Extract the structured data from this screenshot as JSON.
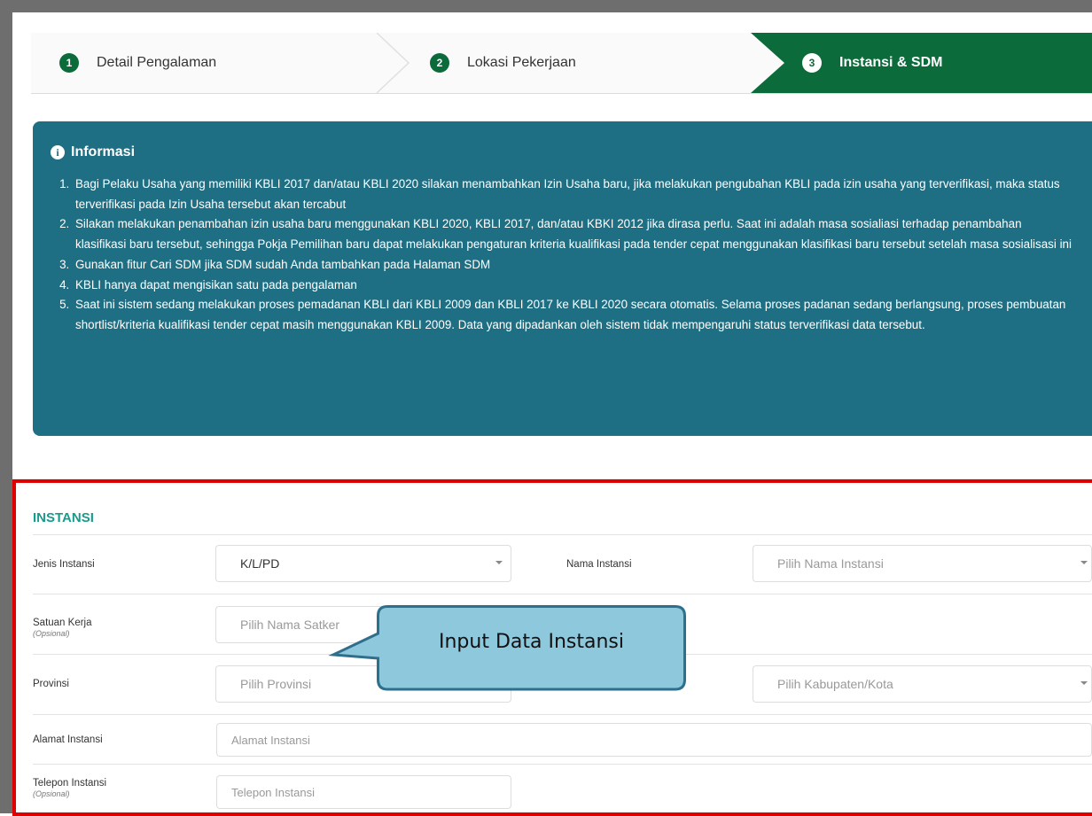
{
  "stepper": {
    "steps": [
      {
        "num": "1",
        "label": "Detail Pengalaman"
      },
      {
        "num": "2",
        "label": "Lokasi Pekerjaan"
      },
      {
        "num": "3",
        "label": "Instansi & SDM"
      }
    ],
    "active_color": "#0b6b3a"
  },
  "info": {
    "title": "Informasi",
    "icon": "info-circle-icon",
    "items": [
      "Bagi Pelaku Usaha yang memiliki KBLI 2017 dan/atau KBLI 2020 silakan menambahkan Izin Usaha baru, jika melakukan pengubahan KBLI pada izin usaha yang terverifikasi, maka status terverifikasi pada Izin Usaha tersebut akan tercabut",
      "Silakan melakukan penambahan izin usaha baru menggunakan KBLI 2020, KBLI 2017, dan/atau KBKI 2012 jika dirasa perlu. Saat ini adalah masa sosialiasi terhadap penambahan klasifikasi baru tersebut, sehingga Pokja Pemilihan baru dapat melakukan pengaturan kriteria kualifikasi pada tender cepat menggunakan klasifikasi baru tersebut setelah masa sosialisasi ini",
      "Gunakan fitur Cari SDM jika SDM sudah Anda tambahkan pada Halaman SDM",
      "KBLI hanya dapat mengisikan satu pada pengalaman",
      "Saat ini sistem sedang melakukan proses pemadanan KBLI dari KBLI 2009 dan KBLI 2017 ke KBLI 2020 secara otomatis. Selama proses padanan sedang berlangsung, proses pembuatan shortlist/kriteria kualifikasi tender cepat masih menggunakan KBLI 2009. Data yang dipadankan oleh sistem tidak mempengaruhi status terverifikasi data tersebut."
    ],
    "bg_color": "#1f6f84"
  },
  "form": {
    "section_title": "INSTANSI",
    "jenis_instansi": {
      "label": "Jenis Instansi",
      "value": "K/L/PD"
    },
    "nama_instansi": {
      "label": "Nama Instansi",
      "placeholder": "Pilih Nama Instansi"
    },
    "satuan_kerja": {
      "label": "Satuan Kerja",
      "note": "(Opsional)",
      "placeholder": "Pilih Nama Satker"
    },
    "provinsi": {
      "label": "Provinsi",
      "placeholder": "Pilih Provinsi"
    },
    "kabupaten": {
      "placeholder": "Pilih Kabupaten/Kota"
    },
    "alamat_instansi": {
      "label": "Alamat Instansi",
      "placeholder": "Alamat Instansi"
    },
    "telepon_instansi": {
      "label": "Telepon Instansi",
      "note": "(Opsional)",
      "placeholder": "Telepon Instansi"
    }
  },
  "callout": {
    "text": "Input Data Instansi"
  }
}
